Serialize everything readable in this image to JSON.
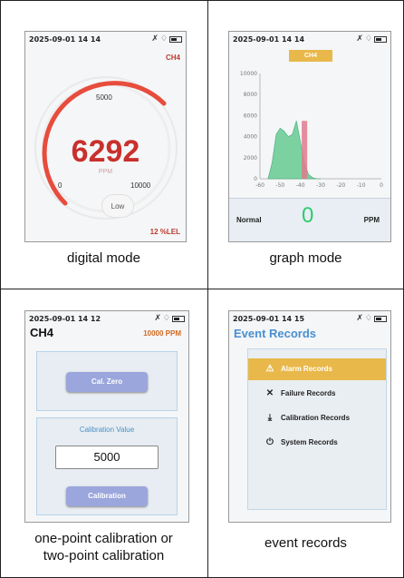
{
  "panels": {
    "digital": {
      "time": "2025-09-01 14 14",
      "gas": "CH4",
      "value": "6292",
      "unit": "PPM",
      "scale_top": "5000",
      "scale_left": "0",
      "scale_right": "10000",
      "level": "Low",
      "lel": "12 %LEL",
      "caption": "digital mode"
    },
    "graph": {
      "time": "2025-09-01 14 14",
      "gas": "CH4",
      "status": "Normal",
      "value": "0",
      "unit": "PPM",
      "caption": "graph mode"
    },
    "calibration": {
      "time": "2025-09-01 14 12",
      "gas": "CH4",
      "range": "10000 PPM",
      "zero_button": "Cal. Zero",
      "value_label": "Calibration Value",
      "value": "5000",
      "cal_button": "Calibration",
      "caption_line1": "one-point calibration or",
      "caption_line2": "two-point calibration"
    },
    "events": {
      "time": "2025-09-01 14 15",
      "title": "Event Records",
      "items": [
        {
          "label": "Alarm Records",
          "icon": "warning-icon"
        },
        {
          "label": "Failure Records",
          "icon": "x-icon"
        },
        {
          "label": "Calibration Records",
          "icon": "download-icon"
        },
        {
          "label": "System Records",
          "icon": "power-icon"
        }
      ],
      "caption": "event records"
    }
  },
  "chart_data": {
    "type": "area",
    "title": "",
    "xlabel": "",
    "ylabel": "",
    "x_ticks": [
      "-60",
      "-50",
      "-40",
      "-30",
      "-20",
      "-10",
      "0"
    ],
    "y_ticks": [
      "0",
      "2000",
      "4000",
      "6000",
      "8000",
      "10000"
    ],
    "ylim": [
      0,
      10000
    ],
    "xlim": [
      -60,
      0
    ],
    "x": [
      -56,
      -54,
      -52,
      -50,
      -48,
      -46,
      -44,
      -42,
      -40,
      -38,
      -36,
      -34,
      -32,
      -30
    ],
    "values": [
      0,
      1500,
      4200,
      4800,
      4500,
      4000,
      4200,
      5500,
      3500,
      1500,
      400,
      100,
      0,
      0
    ],
    "highlight_x": -38,
    "colors": {
      "fill": "#6fcf97",
      "highlight": "#e07a8c"
    }
  },
  "colors": {
    "accent": "#e8b84a",
    "alarm": "#c9302c",
    "button": "#9aa6dc"
  }
}
